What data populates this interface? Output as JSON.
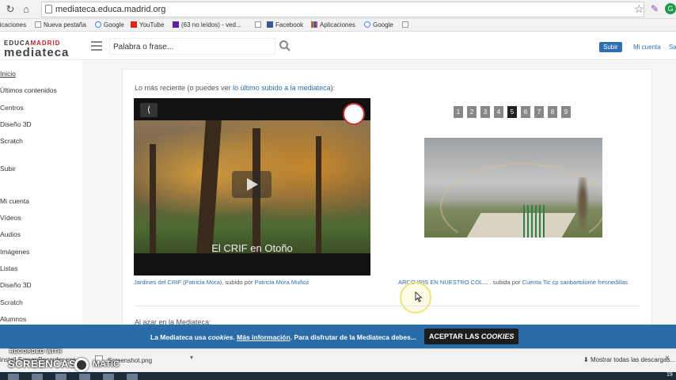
{
  "browser": {
    "url": "mediateca.educa.madrid.org",
    "bookmarks": [
      "licaciones",
      "Nueva pestaña",
      "Google",
      "YouTube",
      "(63 no leídos) - ved...",
      "Facebook",
      "Aplicaciones",
      "Google"
    ]
  },
  "header": {
    "logo_top_a": "EDUCA",
    "logo_top_b": "MADRID",
    "logo_main": "mediateca",
    "search_placeholder": "Palabra o frase...",
    "upload_label": "Subir",
    "account_label": "Mi cuenta",
    "extra_link": "Sa"
  },
  "sidebar": {
    "items": [
      "Inicio",
      "Últimos contenidos",
      "Centros",
      "Diseño 3D",
      "Scratch",
      "Subir",
      "Mi cuenta",
      "Vídeos",
      "Audios",
      "Imágenes",
      "Listas",
      "Diseño 3D",
      "Scratch",
      "Alumnos"
    ]
  },
  "main": {
    "recent_prefix": "Lo más reciente (o puedes ver ",
    "recent_link": "lo último subido a la mediateca",
    "recent_suffix": "):",
    "video_title": "El CRIF en Otoño",
    "video_caption_link": "Jardines del CRIF (Patricia Mora)",
    "video_caption_mid": ", subido por ",
    "video_caption_author": "Patricia Mora Muñoz",
    "pager": [
      "1",
      "2",
      "3",
      "4",
      "5",
      "6",
      "7",
      "8",
      "9"
    ],
    "pager_active": "5",
    "image_caption_link": "ARCO IRIS EN NUESTRO COL...",
    "image_caption_mid": " . subida por ",
    "image_caption_author": "Cuenta Tic cp sanbartolome fresnedillas",
    "random_heading": "Al azar en la Mediateca:"
  },
  "cookie": {
    "text_a": "La Mediateca usa ",
    "text_b": "cookies",
    "text_c": ". ",
    "more_link": "Más información",
    "text_d": ". Para disfrutar de la Mediateca debes...",
    "accept_a": "ACEPTAR LAS ",
    "accept_b": "COOKIES"
  },
  "downloads": {
    "left_text": "install ScreenRecorder.exe",
    "file_name": "Screenshot.png",
    "show_all": "Mostrar todas las descargas..."
  },
  "watermark": {
    "line1": "RECORDED WITH",
    "line2a": "SCREENCAST",
    "line2b": "MATIC"
  },
  "taskbar": {
    "clock": "19"
  }
}
